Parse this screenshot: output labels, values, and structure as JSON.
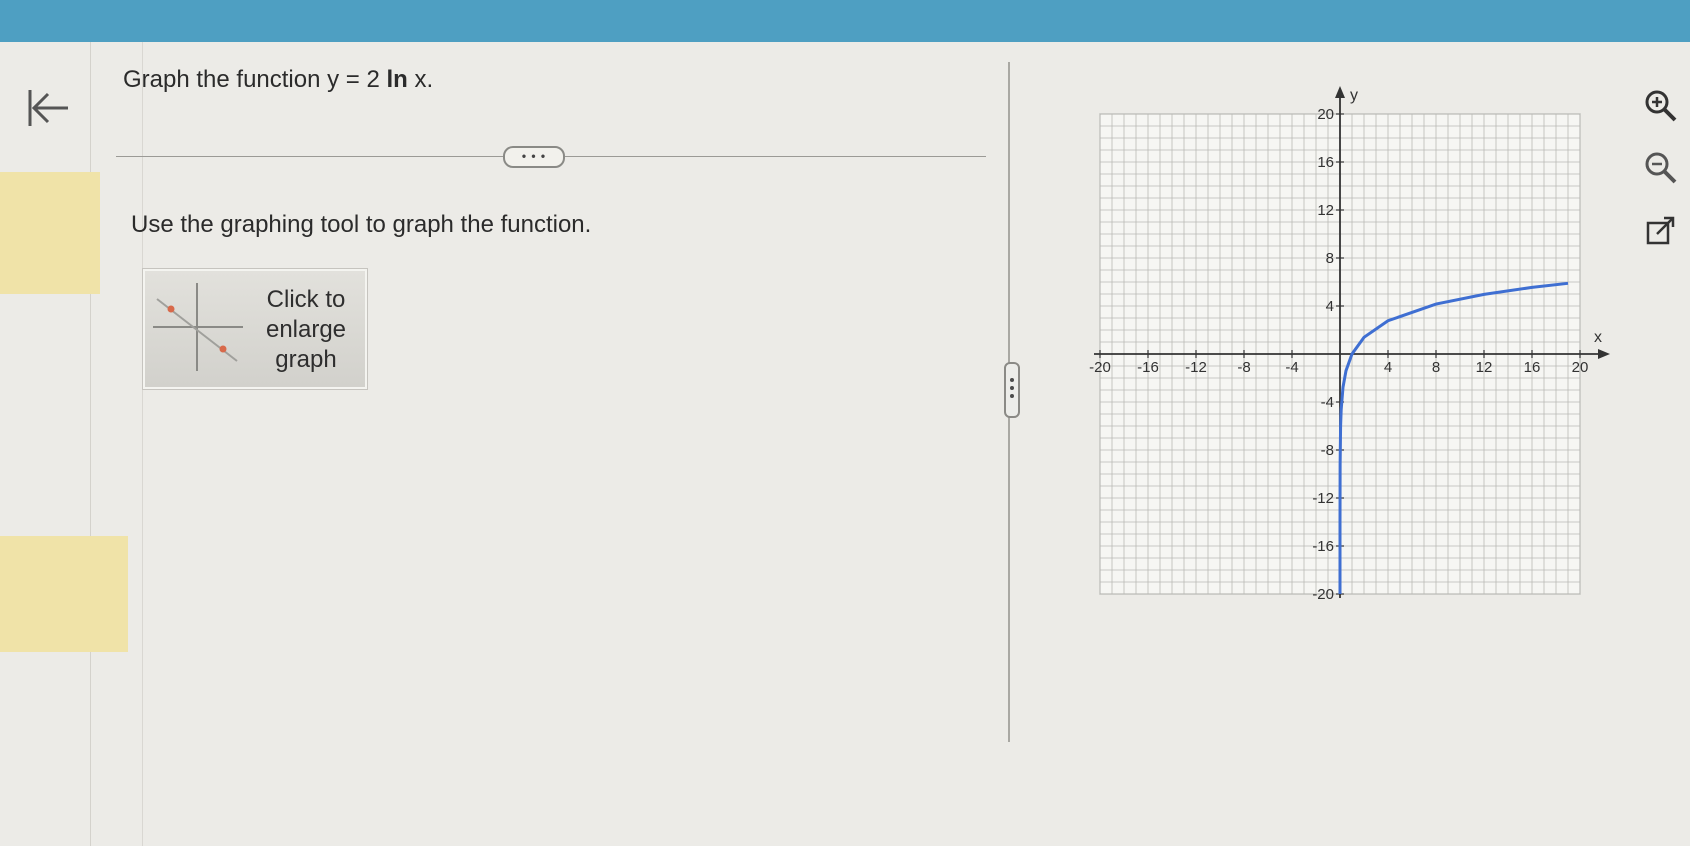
{
  "question": {
    "prefix": "Graph the function y = 2 ",
    "ln": "ln",
    "suffix": " x."
  },
  "more_button": "• • •",
  "instruction": "Use the graphing tool to graph the function.",
  "enlarge_button": {
    "label": "Click to\nenlarge\ngraph"
  },
  "icons": {
    "back": "collapse-left-icon",
    "zoom_in": "zoom-in-icon",
    "zoom_out": "zoom-out-icon",
    "popout": "open-external-icon"
  },
  "colors": {
    "topbar": "#4e9fc2",
    "curve": "#3f6fd2",
    "highlight": "#f0e3a8"
  },
  "chart_data": {
    "type": "line",
    "function": "y = 2 ln x",
    "xlim": [
      -20,
      20
    ],
    "ylim": [
      -20,
      20
    ],
    "minor_step": 1,
    "x_ticks": [
      -20,
      -16,
      -12,
      -8,
      -4,
      4,
      8,
      12,
      16,
      20
    ],
    "y_ticks": [
      -20,
      -16,
      -12,
      -8,
      -4,
      4,
      8,
      12,
      16,
      20
    ],
    "x_tick_labels": [
      "-20",
      "-16",
      "-12",
      "-8",
      "-4",
      "4",
      "8",
      "12",
      "16",
      "20"
    ],
    "y_tick_labels": [
      "-20",
      "-16",
      "-12",
      "-8",
      "-4",
      "4",
      "8",
      "12",
      "16",
      "20"
    ],
    "xlabel": "x",
    "ylabel": "y",
    "grid": true,
    "series": [
      {
        "x": [
          1e-08,
          0.001,
          0.01,
          0.05,
          0.1,
          0.25,
          0.5,
          1,
          2,
          4,
          8,
          12,
          16,
          19
        ],
        "y": [
          -36.84,
          -13.82,
          -9.21,
          -5.99,
          -4.61,
          -2.77,
          -1.39,
          0,
          1.39,
          2.77,
          4.16,
          4.97,
          5.55,
          5.89
        ]
      }
    ]
  }
}
